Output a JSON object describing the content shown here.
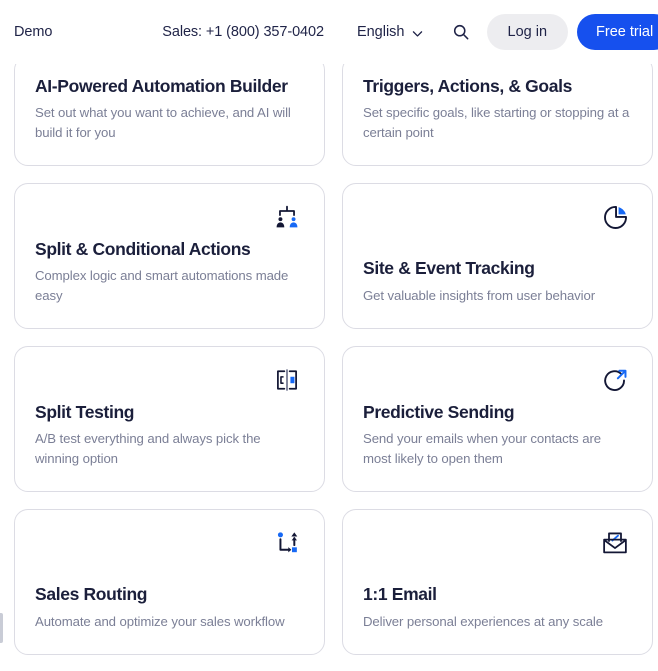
{
  "header": {
    "demo_label": "Demo",
    "sales_label": "Sales: +1 (800) 357-0402",
    "language_label": "English",
    "language_chevron_icon": "chevron-down-icon",
    "search_icon": "search-icon",
    "login_label": "Log in",
    "trial_label": "Free trial",
    "accent_color": "#1650ee",
    "login_bg_color": "#ededf0"
  },
  "cards": [
    {
      "title": "AI-Powered Automation Builder",
      "desc": "Set out what you want to achieve, and AI will build it for you",
      "icon": "none"
    },
    {
      "title": "Triggers, Actions, & Goals",
      "desc": "Set specific goals, like starting or stopping at a certain point",
      "icon": "none"
    },
    {
      "title": "Split & Conditional Actions",
      "desc": "Complex logic and smart automations made easy",
      "icon": "split-users-icon"
    },
    {
      "title": "Site & Event Tracking",
      "desc": "Get valuable insights from user behavior",
      "icon": "pie-chart-icon"
    },
    {
      "title": "Split Testing",
      "desc": "A/B test everything and always pick the winning option",
      "icon": "ab-split-panels-icon"
    },
    {
      "title": "Predictive Sending",
      "desc": "Send your emails when your contacts are most likely to open them",
      "icon": "circle-arrow-out-icon"
    },
    {
      "title": "Sales Routing",
      "desc": "Automate and optimize your sales workflow",
      "icon": "routing-arrows-icon"
    },
    {
      "title": "1:1 Email",
      "desc": "Deliver personal experiences at any scale",
      "icon": "open-envelope-pencil-icon"
    }
  ]
}
